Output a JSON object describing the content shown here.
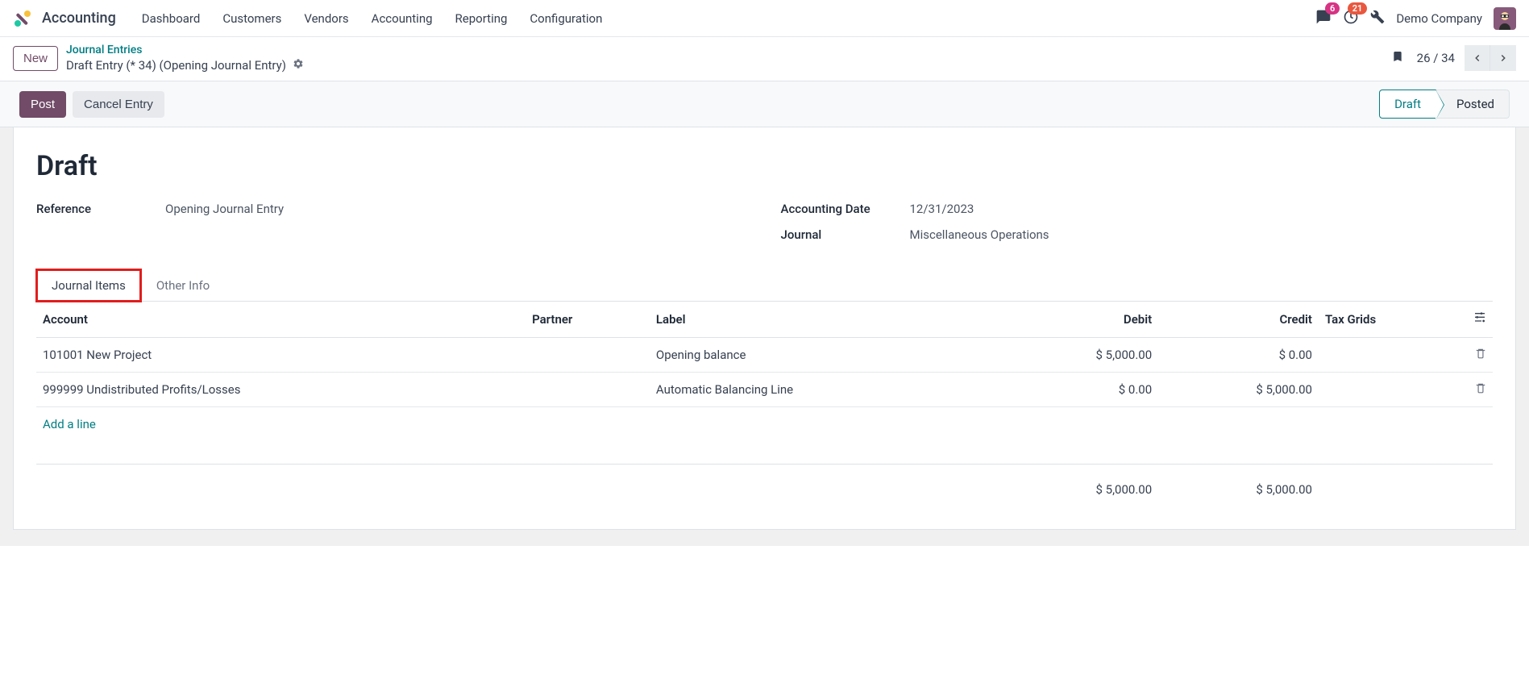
{
  "nav": {
    "appName": "Accounting",
    "items": [
      "Dashboard",
      "Customers",
      "Vendors",
      "Accounting",
      "Reporting",
      "Configuration"
    ],
    "chatBadge": "6",
    "clockBadge": "21",
    "company": "Demo Company"
  },
  "controlRow": {
    "newBtn": "New",
    "bcTop": "Journal Entries",
    "bcBottom": "Draft Entry (* 34) (Opening Journal Entry)",
    "pager": "26 / 34"
  },
  "statusBar": {
    "post": "Post",
    "cancel": "Cancel Entry",
    "steps": {
      "draft": "Draft",
      "posted": "Posted"
    }
  },
  "form": {
    "title": "Draft",
    "referenceLabel": "Reference",
    "referenceValue": "Opening Journal Entry",
    "dateLabel": "Accounting Date",
    "dateValue": "12/31/2023",
    "journalLabel": "Journal",
    "journalValue": "Miscellaneous Operations"
  },
  "tabs": {
    "items": "Journal Items",
    "other": "Other Info"
  },
  "table": {
    "headers": {
      "account": "Account",
      "partner": "Partner",
      "label": "Label",
      "debit": "Debit",
      "credit": "Credit",
      "taxGrids": "Tax Grids"
    },
    "rows": [
      {
        "account": "101001 New Project",
        "partner": "",
        "label": "Opening balance",
        "debit": "$ 5,000.00",
        "credit": "$ 0.00",
        "taxGrids": ""
      },
      {
        "account": "999999 Undistributed Profits/Losses",
        "partner": "",
        "label": "Automatic Balancing Line",
        "debit": "$ 0.00",
        "credit": "$ 5,000.00",
        "taxGrids": ""
      }
    ],
    "addLine": "Add a line",
    "totals": {
      "debit": "$ 5,000.00",
      "credit": "$ 5,000.00"
    }
  }
}
